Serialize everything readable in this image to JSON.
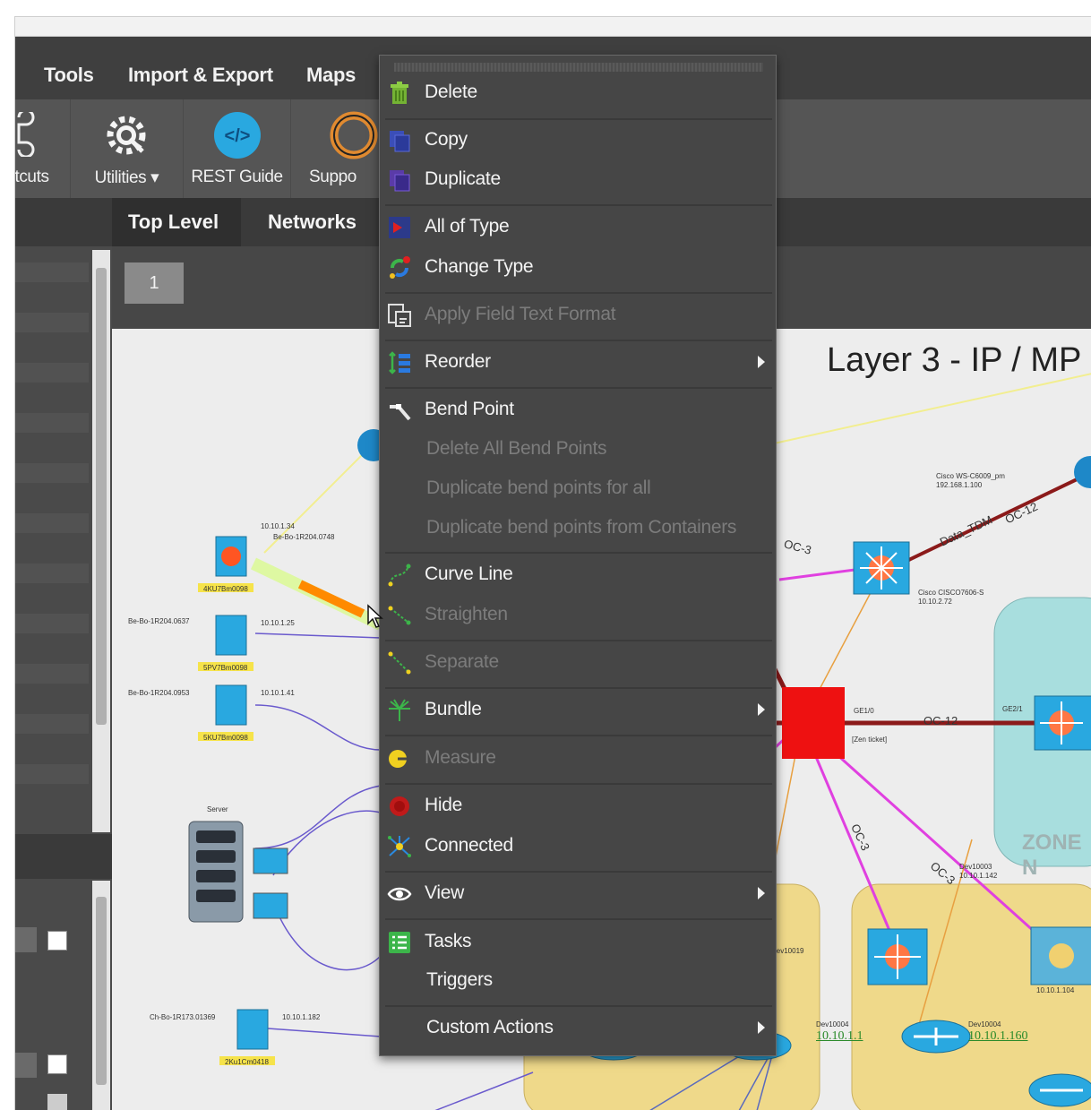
{
  "menubar": {
    "items": [
      "Tools",
      "Import & Export",
      "Maps"
    ]
  },
  "toolbar": {
    "shortcuts_label": "tcuts",
    "utilities_label": "Utilities",
    "rest_guide_label": "REST Guide",
    "support_label": "Suppo"
  },
  "tabs": [
    "Top Level",
    "Networks"
  ],
  "page": {
    "number": "1"
  },
  "diagram": {
    "title": "Layer 3 - IP / MP",
    "zone_label": "ZONE N",
    "labels": {
      "dev_a_ip": "10.10.1.34",
      "dev_a_name": "Be-Bo-1R204.0748",
      "dev_a_tag": "4KU7Bm0098",
      "dev_b_name": "Be-Bo-1R204.0637",
      "dev_b_ip": "10.10.1.25",
      "dev_b_tag": "5PV7Bm0098",
      "dev_c_name": "Be-Bo-1R204.0953",
      "dev_c_ip": "10.10.1.41",
      "dev_c_tag": "5KU7Bm0098",
      "server": "Server",
      "dev_d_name": "Ch-Bo-1R173.01369",
      "dev_d_ip": "10.10.1.182",
      "dev_d_tag": "2Ku1Cm0418",
      "cisco_top": "Cisco WS-C6009_pm",
      "cisco_top_ip": "192.168.1.100",
      "data_tdm": "Data_TDM",
      "oc12_a": "OC-12",
      "oc3": "OC-3",
      "cisco_mid": "Cisco CISCO7606-S",
      "cisco_mid_ip": "10.10.2.72",
      "ge10": "GE1/0",
      "zen_ticket": "[Zen ticket]",
      "oc12_b": "OC-12",
      "ge21": "GE2/1",
      "dev10003": "Dev10003",
      "dev10003_ip": "10.10.1.142",
      "dev10019": "Dev10019",
      "dev10004": "Dev10004",
      "dev10004_ip": "10.10.1.1",
      "dev10004b": "Dev10004",
      "dev10004b_ip": "10.10.1.160",
      "ip_right": "10.10.1.104",
      "oc3_b": "OC-3",
      "oc3_c": "OC-3"
    }
  },
  "context_menu": {
    "items": [
      {
        "label": "Delete",
        "icon": "trash-icon",
        "enabled": true
      },
      {
        "label": "Copy",
        "icon": "copy-icon",
        "enabled": true
      },
      {
        "label": "Duplicate",
        "icon": "duplicate-icon",
        "enabled": true
      },
      {
        "label": "All of Type",
        "icon": "all-of-type-icon",
        "enabled": true
      },
      {
        "label": "Change Type",
        "icon": "change-type-icon",
        "enabled": true
      },
      {
        "label": "Apply Field Text Format",
        "icon": "format-icon",
        "enabled": false
      },
      {
        "label": "Reorder",
        "icon": "reorder-icon",
        "enabled": true,
        "submenu": true
      },
      {
        "label": "Bend Point",
        "icon": "bend-point-icon",
        "enabled": true
      },
      {
        "label": "Delete All Bend Points",
        "enabled": false
      },
      {
        "label": "Duplicate bend points for all",
        "enabled": false
      },
      {
        "label": "Duplicate bend points from Containers",
        "enabled": false
      },
      {
        "label": "Curve Line",
        "icon": "curve-line-icon",
        "enabled": true
      },
      {
        "label": "Straighten",
        "icon": "straighten-icon",
        "enabled": false
      },
      {
        "label": "Separate",
        "icon": "separate-icon",
        "enabled": false
      },
      {
        "label": "Bundle",
        "icon": "bundle-icon",
        "enabled": true,
        "submenu": true
      },
      {
        "label": "Measure",
        "icon": "measure-icon",
        "enabled": false
      },
      {
        "label": "Hide",
        "icon": "hide-icon",
        "enabled": true
      },
      {
        "label": "Connected",
        "icon": "connected-icon",
        "enabled": true
      },
      {
        "label": "View",
        "icon": "eye-icon",
        "enabled": true,
        "submenu": true
      },
      {
        "label": "Tasks",
        "icon": "tasks-icon",
        "enabled": true
      },
      {
        "label": "Triggers",
        "enabled": true
      },
      {
        "label": "Custom Actions",
        "enabled": true,
        "submenu": true
      }
    ]
  },
  "colors": {
    "menu_bg": "#464646",
    "toolbar_bg": "#555555",
    "accent_blue": "#29a8e0",
    "link_red": "#8b1a1a",
    "link_magenta": "#e040e0",
    "link_purple": "#6a5acd",
    "router_red": "#ee1111",
    "zone_teal": "#a8dede",
    "zone_yellow": "#efd98a"
  }
}
